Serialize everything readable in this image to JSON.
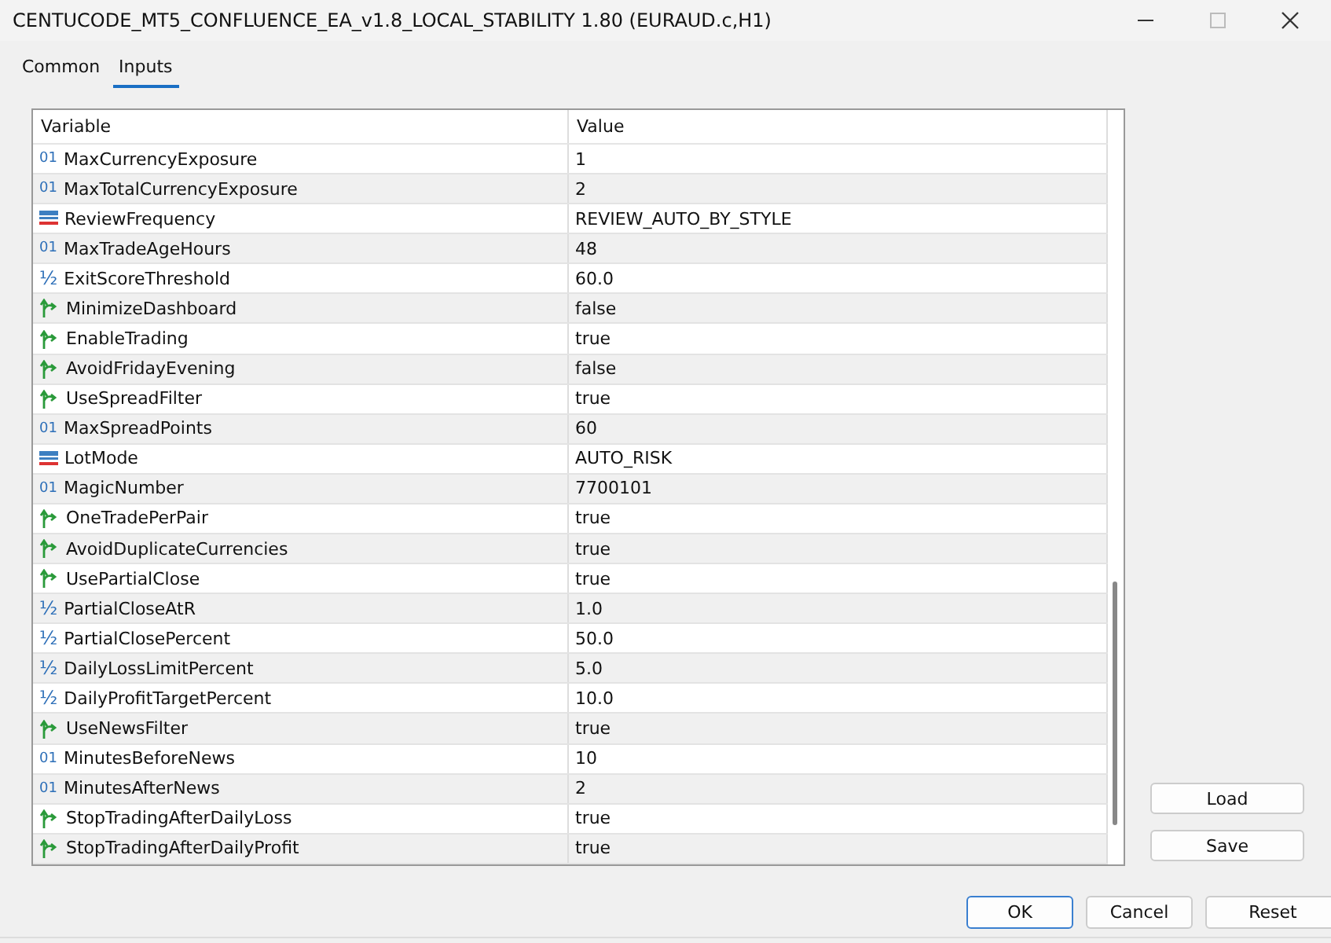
{
  "window": {
    "title": "CENTUCODE_MT5_CONFLUENCE_EA_v1.8_LOCAL_STABILITY 1.80 (EURAUD.c,H1)"
  },
  "tabs": [
    {
      "label": "Common",
      "selected": false
    },
    {
      "label": "Inputs",
      "selected": true
    }
  ],
  "table": {
    "columns": [
      "Variable",
      "Value"
    ],
    "rows": [
      {
        "kind": "int",
        "icon": "01",
        "variable": "MaxCurrencyExposure",
        "value": "1"
      },
      {
        "kind": "int",
        "icon": "01",
        "variable": "MaxTotalCurrencyExposure",
        "value": "2"
      },
      {
        "kind": "enum",
        "variable": "ReviewFrequency",
        "value": "REVIEW_AUTO_BY_STYLE"
      },
      {
        "kind": "int",
        "icon": "01",
        "variable": "MaxTradeAgeHours",
        "value": "48"
      },
      {
        "kind": "double",
        "icon": "½",
        "variable": "ExitScoreThreshold",
        "value": "60.0"
      },
      {
        "kind": "bool",
        "variable": "MinimizeDashboard",
        "value": "false"
      },
      {
        "kind": "bool",
        "variable": "EnableTrading",
        "value": "true"
      },
      {
        "kind": "bool",
        "variable": "AvoidFridayEvening",
        "value": "false"
      },
      {
        "kind": "bool",
        "variable": "UseSpreadFilter",
        "value": "true"
      },
      {
        "kind": "int",
        "icon": "01",
        "variable": "MaxSpreadPoints",
        "value": "60"
      },
      {
        "kind": "enum",
        "variable": "LotMode",
        "value": "AUTO_RISK"
      },
      {
        "kind": "int",
        "icon": "01",
        "variable": "MagicNumber",
        "value": "7700101"
      },
      {
        "kind": "bool",
        "variable": "OneTradePerPair",
        "value": "true"
      },
      {
        "kind": "bool",
        "variable": "AvoidDuplicateCurrencies",
        "value": "true"
      },
      {
        "kind": "bool",
        "variable": "UsePartialClose",
        "value": "true"
      },
      {
        "kind": "double",
        "icon": "½",
        "variable": "PartialCloseAtR",
        "value": "1.0"
      },
      {
        "kind": "double",
        "icon": "½",
        "variable": "PartialClosePercent",
        "value": "50.0"
      },
      {
        "kind": "double",
        "icon": "½",
        "variable": "DailyLossLimitPercent",
        "value": "5.0"
      },
      {
        "kind": "double",
        "icon": "½",
        "variable": "DailyProfitTargetPercent",
        "value": "10.0"
      },
      {
        "kind": "bool",
        "variable": "UseNewsFilter",
        "value": "true"
      },
      {
        "kind": "int",
        "icon": "01",
        "variable": "MinutesBeforeNews",
        "value": "10"
      },
      {
        "kind": "int",
        "icon": "01",
        "variable": "MinutesAfterNews",
        "value": "2"
      },
      {
        "kind": "bool",
        "variable": "StopTradingAfterDailyLoss",
        "value": "true"
      },
      {
        "kind": "bool",
        "variable": "StopTradingAfterDailyProfit",
        "value": "true"
      }
    ]
  },
  "side_buttons": [
    "Load",
    "Save"
  ],
  "buttons": [
    {
      "label": "OK",
      "kind": "default"
    },
    {
      "label": "Cancel",
      "kind": "normal"
    },
    {
      "label": "Reset",
      "kind": "normal"
    }
  ]
}
